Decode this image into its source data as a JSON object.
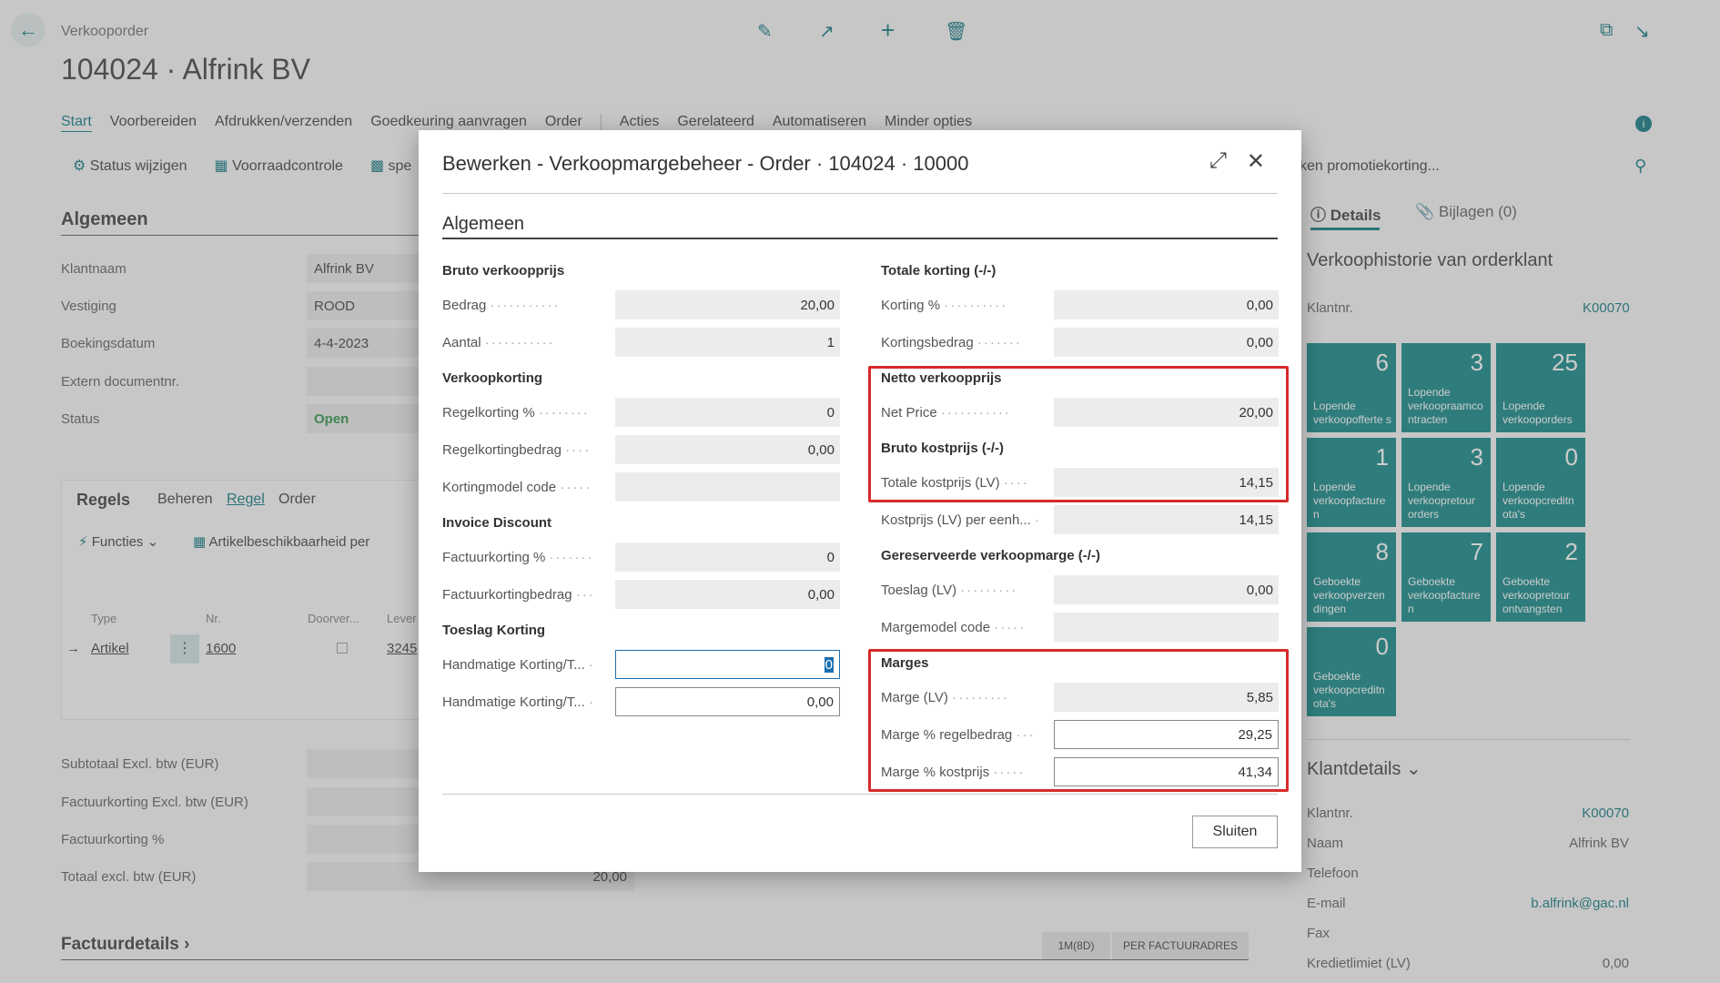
{
  "page": {
    "breadcrumb": "Verkooporder",
    "title": "104024 · Alfrink BV",
    "menu": [
      "Start",
      "Voorbereiden",
      "Afdrukken/verzenden",
      "Goedkeuring aanvragen",
      "Order",
      "Acties",
      "Gerelateerd",
      "Automatiseren",
      "Minder opties"
    ],
    "actions": [
      "Status wijzigen",
      "Voorraadcontrole",
      "spe"
    ],
    "promo_text": "ken promotiekorting...",
    "algemeen_heading": "Algemeen",
    "general_fields": [
      {
        "label": "Klantnaam",
        "value": "Alfrink BV"
      },
      {
        "label": "Vestiging",
        "value": "ROOD"
      },
      {
        "label": "Boekingsdatum",
        "value": "4-4-2023"
      },
      {
        "label": "Extern documentnr.",
        "value": ""
      },
      {
        "label": "Status",
        "value": "Open"
      }
    ],
    "lines_tabs": [
      "Regels",
      "Beheren",
      "Regel",
      "Order"
    ],
    "lines_actions": [
      "Functies",
      "Artikelbeschikbaarheid per"
    ],
    "lines_columns": [
      "Type",
      "Nr.",
      "Doorver...",
      "Lever"
    ],
    "lines_row": {
      "type": "Artikel",
      "nr": "1600",
      "lever": "3245"
    },
    "totals": [
      {
        "label": "Subtotaal Excl. btw (EUR)",
        "value": ""
      },
      {
        "label": "Factuurkorting Excl. btw (EUR)",
        "value": ""
      },
      {
        "label": "Factuurkorting %",
        "value": ""
      },
      {
        "label": "Totaal excl. btw (EUR)",
        "value": "20,00"
      }
    ],
    "factuur_heading": "Factuurdetails",
    "factuur_chips": [
      "1M(8D)",
      "PER FACTUURADRES"
    ]
  },
  "sidebar": {
    "tabs": [
      "Details",
      "Bijlagen (0)"
    ],
    "history_title": "Verkoophistorie van orderklant",
    "klantnr_label": "Klantnr.",
    "klantnr_value": "K00070",
    "tiles": [
      {
        "num": "6",
        "label": "Lopende verkoopofferte s"
      },
      {
        "num": "3",
        "label": "Lopende verkoopraamco ntracten"
      },
      {
        "num": "25",
        "label": "Lopende verkooporders"
      },
      {
        "num": "1",
        "label": "Lopende verkoopfacture n"
      },
      {
        "num": "3",
        "label": "Lopende verkoopretour orders"
      },
      {
        "num": "0",
        "label": "Lopende verkoopcreditn ota's"
      },
      {
        "num": "8",
        "label": "Geboekte verkoopverzen dingen"
      },
      {
        "num": "7",
        "label": "Geboekte verkoopfacture n"
      },
      {
        "num": "2",
        "label": "Geboekte verkoopretour ontvangsten"
      },
      {
        "num": "0",
        "label": "Geboekte verkoopcreditn ota's"
      }
    ],
    "klantdetails_title": "Klantdetails",
    "klantdetails": [
      {
        "label": "Klantnr.",
        "value": "K00070",
        "link": true
      },
      {
        "label": "Naam",
        "value": "Alfrink BV",
        "link": false
      },
      {
        "label": "Telefoon",
        "value": "",
        "link": false
      },
      {
        "label": "E-mail",
        "value": "b.alfrink@gac.nl",
        "link": true
      },
      {
        "label": "Fax",
        "value": "",
        "link": false
      },
      {
        "label": "Kredietlimiet (LV)",
        "value": "0,00",
        "link": false
      }
    ]
  },
  "dialog": {
    "title": "Bewerken - Verkoopmargebeheer - Order · 104024 · 10000",
    "section": "Algemeen",
    "left": {
      "bruto_heading": "Bruto verkoopprijs",
      "bedrag_label": "Bedrag",
      "bedrag": "20,00",
      "aantal_label": "Aantal",
      "aantal": "1",
      "verkoopkorting_heading": "Verkoopkorting",
      "regelkorting_pct_label": "Regelkorting %",
      "regelkorting_pct": "0",
      "regelkortingbedrag_label": "Regelkortingbedrag",
      "regelkortingbedrag": "0,00",
      "kortingmodel_label": "Kortingmodel code",
      "kortingmodel": "",
      "invoice_heading": "Invoice Discount",
      "factuurkorting_pct_label": "Factuurkorting %",
      "factuurkorting_pct": "0",
      "factuurkortingbedrag_label": "Factuurkortingbedrag",
      "factuurkortingbedrag": "0,00",
      "toeslag_heading": "Toeslag Korting",
      "handm1_label": "Handmatige Korting/T...",
      "handm1": "0",
      "handm2_label": "Handmatige Korting/T...",
      "handm2": "0,00"
    },
    "right": {
      "totale_korting_heading": "Totale korting (-/-)",
      "korting_pct_label": "Korting %",
      "korting_pct": "0,00",
      "kortingsbedrag_label": "Kortingsbedrag",
      "kortingsbedrag": "0,00",
      "netto_heading": "Netto verkoopprijs",
      "net_price_label": "Net Price",
      "net_price": "20,00",
      "bruto_kost_heading": "Bruto kostprijs (-/-)",
      "totale_kostprijs_label": "Totale kostprijs (LV)",
      "totale_kostprijs": "14,15",
      "kostprijs_eenh_label": "Kostprijs (LV) per eenh...",
      "kostprijs_eenh": "14,15",
      "gereserveerde_heading": "Gereserveerde verkoopmarge (-/-)",
      "toeslag_label": "Toeslag (LV)",
      "toeslag": "0,00",
      "margemodel_label": "Margemodel code",
      "margemodel": "",
      "marges_heading": "Marges",
      "marge_lv_label": "Marge (LV)",
      "marge_lv": "5,85",
      "marge_regel_label": "Marge % regelbedrag",
      "marge_regel": "29,25",
      "marge_kost_label": "Marge % kostprijs",
      "marge_kost": "41,34"
    },
    "close_label": "Sluiten"
  },
  "colors": {
    "accent": "#00707a",
    "tile": "#00807f",
    "highlight": "#d72a2a"
  }
}
